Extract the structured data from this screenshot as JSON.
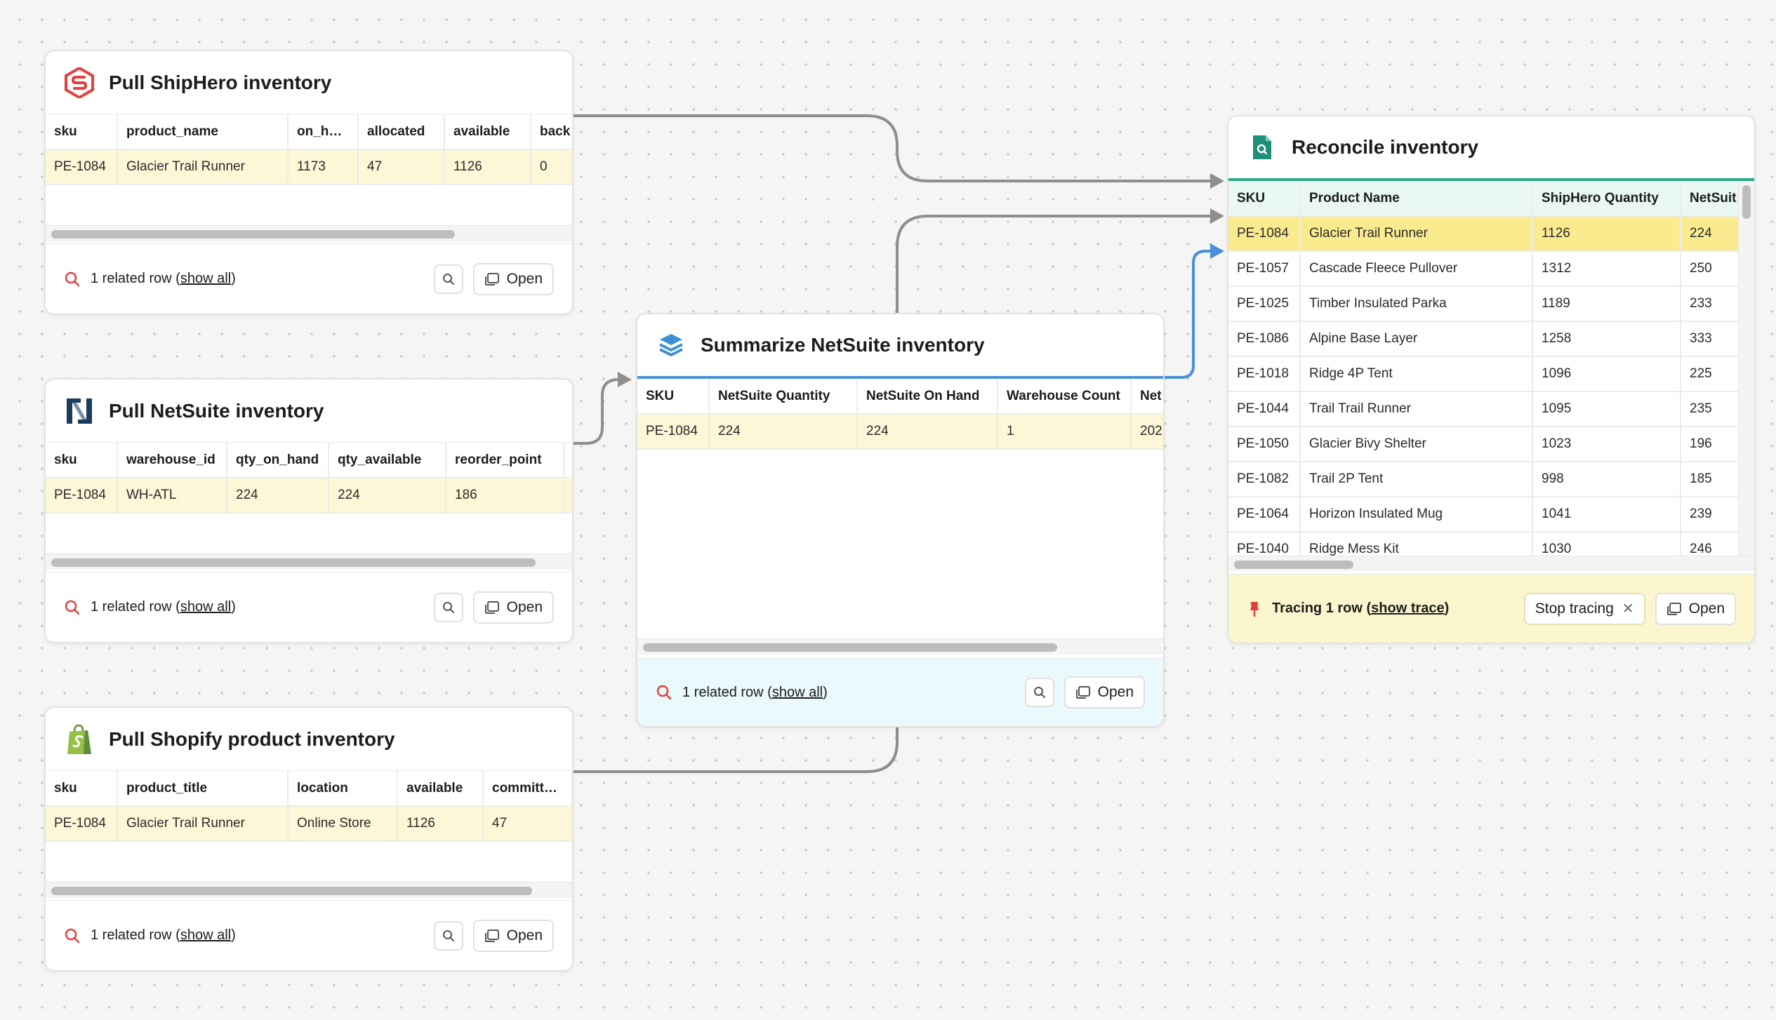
{
  "cards": {
    "shiphero": {
      "title": "Pull ShipHero inventory",
      "columns": [
        "sku",
        "product_name",
        "on_ha…",
        "allocated",
        "available",
        "back"
      ],
      "row": [
        "PE-1084",
        "Glacier Trail Runner",
        "1173",
        "47",
        "1126",
        "0"
      ],
      "footer": {
        "prefix": "1 related row (",
        "link": "show all",
        "suffix": ")",
        "open_label": "Open"
      }
    },
    "netsuite": {
      "title": "Pull NetSuite inventory",
      "columns": [
        "sku",
        "warehouse_id",
        "qty_on_hand",
        "qty_available",
        "reorder_point"
      ],
      "row": [
        "PE-1084",
        "WH-ATL",
        "224",
        "224",
        "186"
      ],
      "footer": {
        "prefix": "1 related row (",
        "link": "show all",
        "suffix": ")",
        "open_label": "Open"
      }
    },
    "shopify": {
      "title": "Pull Shopify product inventory",
      "columns": [
        "sku",
        "product_title",
        "location",
        "available",
        "committ…"
      ],
      "row": [
        "PE-1084",
        "Glacier Trail Runner",
        "Online Store",
        "1126",
        "47"
      ],
      "footer": {
        "prefix": "1 related row (",
        "link": "show all",
        "suffix": ")",
        "open_label": "Open"
      }
    },
    "summary": {
      "title": "Summarize NetSuite inventory",
      "columns": [
        "SKU",
        "NetSuite Quantity",
        "NetSuite On Hand",
        "Warehouse Count",
        "Net"
      ],
      "row": [
        "PE-1084",
        "224",
        "224",
        "1",
        "202"
      ],
      "footer": {
        "prefix": "1 related row (",
        "link": "show all",
        "suffix": ")",
        "open_label": "Open"
      }
    },
    "reconcile": {
      "title": "Reconcile inventory",
      "columns": [
        "SKU",
        "Product Name",
        "ShipHero Quantity",
        "NetSuit"
      ],
      "rows": [
        [
          "PE-1084",
          "Glacier Trail Runner",
          "1126",
          "224"
        ],
        [
          "PE-1057",
          "Cascade Fleece Pullover",
          "1312",
          "250"
        ],
        [
          "PE-1025",
          "Timber Insulated Parka",
          "1189",
          "233"
        ],
        [
          "PE-1086",
          "Alpine Base Layer",
          "1258",
          "333"
        ],
        [
          "PE-1018",
          "Ridge 4P Tent",
          "1096",
          "225"
        ],
        [
          "PE-1044",
          "Trail Trail Runner",
          "1095",
          "235"
        ],
        [
          "PE-1050",
          "Glacier Bivy Shelter",
          "1023",
          "196"
        ],
        [
          "PE-1082",
          "Trail 2P Tent",
          "998",
          "185"
        ],
        [
          "PE-1064",
          "Horizon Insulated Mug",
          "1041",
          "239"
        ],
        [
          "PE-1040",
          "Ridge Mess Kit",
          "1030",
          "246"
        ]
      ],
      "footer": {
        "prefix": "Tracing 1 row (",
        "link": "show trace",
        "suffix": ")",
        "stop_label": "Stop tracing",
        "open_label": "Open"
      }
    }
  },
  "colors": {
    "highlight_row": "#fdf7d8",
    "selected_row": "#fbeb8f",
    "reconcile_accent": "#2aa88a",
    "summary_accent": "#4a90d9",
    "edge_gray": "#8e8e8e",
    "edge_blue": "#4a90d9",
    "tracing_footer": "#fcf6cf",
    "summary_footer": "#eaf9fb"
  }
}
